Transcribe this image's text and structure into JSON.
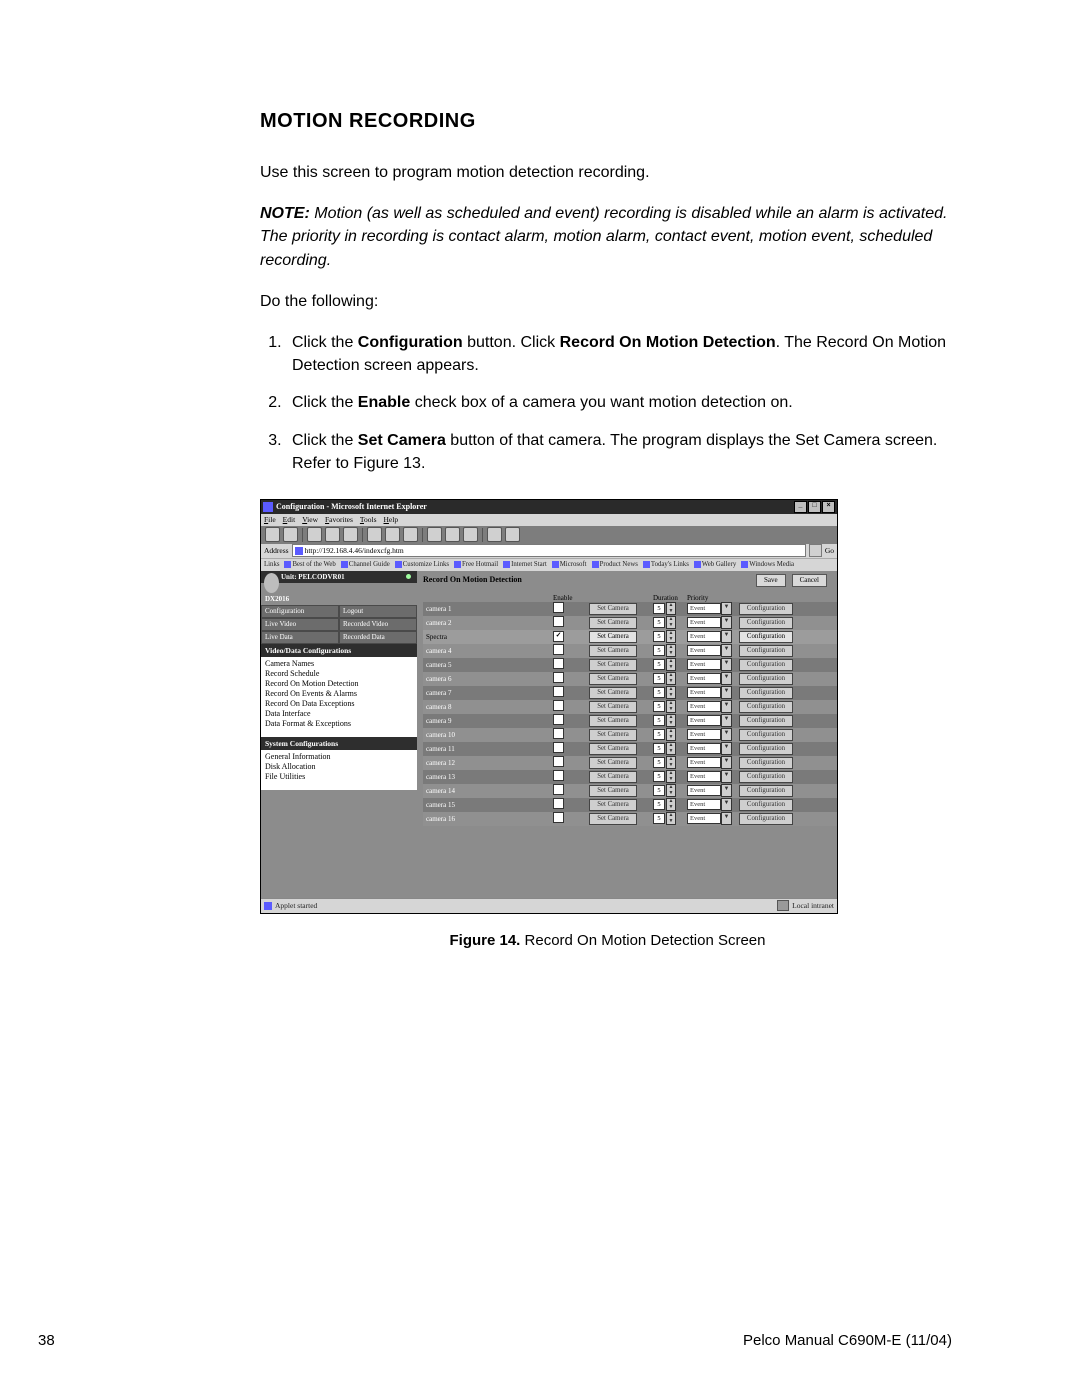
{
  "heading": "MOTION RECORDING",
  "intro": "Use this screen to program motion detection recording.",
  "note_label": "NOTE:",
  "note_body": "Motion (as well as scheduled and event) recording is disabled while an alarm is activated. The priority in recording is contact alarm, motion alarm, contact event, motion event, scheduled recording.",
  "do_following": "Do the following:",
  "steps": [
    {
      "pre": "Click the ",
      "b1": "Configuration",
      "mid": " button. Click ",
      "b2": "Record On Motion Detection",
      "post": ". The Record On Motion Detection screen appears."
    },
    {
      "pre": "Click the ",
      "b1": "Enable",
      "mid": " check box of a camera you want motion detection on.",
      "b2": "",
      "post": ""
    },
    {
      "pre": "Click the ",
      "b1": "Set Camera",
      "mid": " button of that camera. The program displays the Set Camera screen. Refer to Figure 13.",
      "b2": "",
      "post": ""
    }
  ],
  "caption_b": "Figure 14.",
  "caption_t": "  Record On Motion Detection Screen",
  "page_number": "38",
  "manual_id": "Pelco Manual C690M-E (11/04)",
  "shot": {
    "title": "Configuration - Microsoft Internet Explorer",
    "winbtns": [
      "_",
      "□",
      "×"
    ],
    "menu": [
      "File",
      "Edit",
      "View",
      "Favorites",
      "Tools",
      "Help"
    ],
    "address_label": "Address",
    "address_url": "http://192.168.4.46/indexcfg.htm",
    "go": "Go",
    "links_label": "Links",
    "links": [
      "Best of the Web",
      "Channel Guide",
      "Customize Links",
      "Free Hotmail",
      "Internet Start",
      "Microsoft",
      "Product News",
      "Today's Links",
      "Web Gallery",
      "Windows Media"
    ],
    "unit": "Unit: PELCODVR01",
    "brand": "DX2016",
    "nav": [
      "Configuration",
      "Logout",
      "Live Video",
      "Recorded Video",
      "Live Data",
      "Recorded Data"
    ],
    "sec1_h": "Video/Data Configurations",
    "sec1": [
      "Camera Names",
      "Record Schedule",
      "Record On Motion Detection",
      "Record On Events & Alarms",
      "Record On Data Exceptions",
      "Data Interface",
      "Data Format & Exceptions"
    ],
    "sec2_h": "System Configurations",
    "sec2": [
      "General Information",
      "Disk Allocation",
      "File Utilities"
    ],
    "panel_title": "Record On Motion Detection",
    "save": "Save",
    "cancel": "Cancel",
    "col_enable": "Enable",
    "col_duration": "Duration",
    "col_priority": "Priority",
    "set_camera": "Set Camera",
    "priority_val": "Event",
    "cfg": "Configuration",
    "dur": "5",
    "rows": [
      {
        "name": "camera 1",
        "active": false,
        "checked": false
      },
      {
        "name": "camera 2",
        "active": false,
        "checked": false
      },
      {
        "name": "Spectra",
        "active": true,
        "checked": true
      },
      {
        "name": "camera 4",
        "active": false,
        "checked": false
      },
      {
        "name": "camera 5",
        "active": false,
        "checked": false
      },
      {
        "name": "camera 6",
        "active": false,
        "checked": false
      },
      {
        "name": "camera 7",
        "active": false,
        "checked": false
      },
      {
        "name": "camera 8",
        "active": false,
        "checked": false
      },
      {
        "name": "camera 9",
        "active": false,
        "checked": false
      },
      {
        "name": "camera 10",
        "active": false,
        "checked": false
      },
      {
        "name": "camera 11",
        "active": false,
        "checked": false
      },
      {
        "name": "camera 12",
        "active": false,
        "checked": false
      },
      {
        "name": "camera 13",
        "active": false,
        "checked": false
      },
      {
        "name": "camera 14",
        "active": false,
        "checked": false
      },
      {
        "name": "camera 15",
        "active": false,
        "checked": false
      },
      {
        "name": "camera 16",
        "active": false,
        "checked": false
      }
    ],
    "status_left": "Applet started",
    "status_right": "Local intranet"
  }
}
